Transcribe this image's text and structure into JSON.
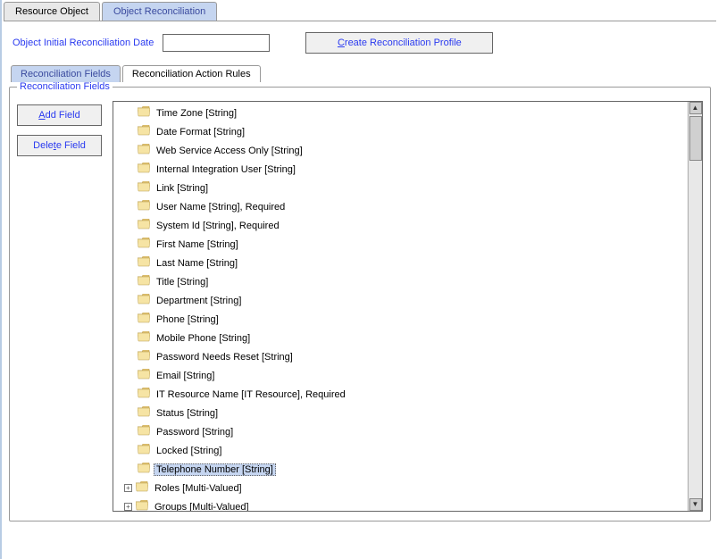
{
  "topTabs": {
    "resource": "Resource Object",
    "reconciliation": "Object Reconciliation"
  },
  "dateRow": {
    "label": "Object Initial Reconciliation Date",
    "createBtn": {
      "u": "C",
      "rest": "reate Reconciliation Profile"
    }
  },
  "innerTabs": {
    "fields": "Reconciliation Fields",
    "rules": "Reconciliation Action Rules"
  },
  "fieldset": {
    "legend": "Reconciliation Fields",
    "addBtn": {
      "u": "A",
      "rest": "dd Field"
    },
    "delBtn": {
      "pre": "Dele",
      "u": "t",
      "rest": "e Field"
    }
  },
  "fields": [
    {
      "label": "Time Zone [String]",
      "expandable": false,
      "selected": false
    },
    {
      "label": "Date Format [String]",
      "expandable": false,
      "selected": false
    },
    {
      "label": "Web Service Access Only [String]",
      "expandable": false,
      "selected": false
    },
    {
      "label": "Internal Integration User [String]",
      "expandable": false,
      "selected": false
    },
    {
      "label": "Link [String]",
      "expandable": false,
      "selected": false
    },
    {
      "label": "User Name [String], Required",
      "expandable": false,
      "selected": false
    },
    {
      "label": "System Id [String], Required",
      "expandable": false,
      "selected": false
    },
    {
      "label": "First Name [String]",
      "expandable": false,
      "selected": false
    },
    {
      "label": "Last Name [String]",
      "expandable": false,
      "selected": false
    },
    {
      "label": "Title [String]",
      "expandable": false,
      "selected": false
    },
    {
      "label": "Department [String]",
      "expandable": false,
      "selected": false
    },
    {
      "label": "Phone [String]",
      "expandable": false,
      "selected": false
    },
    {
      "label": "Mobile Phone [String]",
      "expandable": false,
      "selected": false
    },
    {
      "label": "Password Needs Reset [String]",
      "expandable": false,
      "selected": false
    },
    {
      "label": "Email [String]",
      "expandable": false,
      "selected": false
    },
    {
      "label": "IT Resource Name [IT Resource], Required",
      "expandable": false,
      "selected": false
    },
    {
      "label": "Status [String]",
      "expandable": false,
      "selected": false
    },
    {
      "label": "Password [String]",
      "expandable": false,
      "selected": false
    },
    {
      "label": "Locked [String]",
      "expandable": false,
      "selected": false
    },
    {
      "label": "Telephone Number [String]",
      "expandable": false,
      "selected": true
    },
    {
      "label": "Roles [Multi-Valued]",
      "expandable": true,
      "selected": false
    },
    {
      "label": "Groups [Multi-Valued]",
      "expandable": true,
      "selected": false
    }
  ]
}
